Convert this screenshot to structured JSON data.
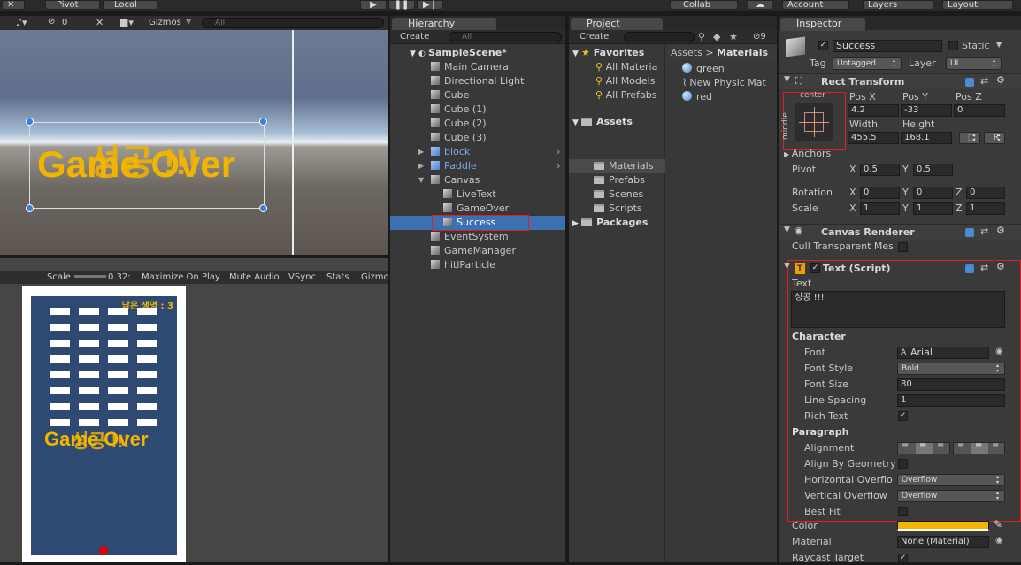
{
  "toolbar": {
    "pivot": "Pivot",
    "local": "Local",
    "collab": "Collab",
    "account": "Account",
    "layers": "Layers",
    "layout": "Layout"
  },
  "scene": {
    "gizmos": "Gizmos",
    "search_placeholder": "All",
    "layers_count": "0",
    "overlay_a": "Game Over",
    "overlay_b": "성공 !!!"
  },
  "game": {
    "scale_label": "Scale",
    "scale_value": "0.32:",
    "maximize": "Maximize On Play",
    "mute": "Mute Audio",
    "vsync": "VSync",
    "stats": "Stats",
    "gizmos": "Gizmo",
    "lives": "남은 생명 : 3",
    "overlay_a": "Game Over",
    "overlay_b": "성공 !!!"
  },
  "hierarchy": {
    "tab": "Hierarchy",
    "create": "Create",
    "search_placeholder": "All",
    "scene": "SampleScene*",
    "items": [
      "Main Camera",
      "Directional Light",
      "Cube",
      "Cube (1)",
      "Cube (2)",
      "Cube (3)",
      "block",
      "Paddle",
      "Canvas",
      "LiveText",
      "GameOver",
      "Success",
      "EventSystem",
      "GameManager",
      "hitlParticle"
    ]
  },
  "project": {
    "tab": "Project",
    "create": "Create",
    "badge": "9",
    "favorites": "Favorites",
    "fav_items": [
      "All Materia",
      "All Models",
      "All Prefabs"
    ],
    "assets": "Assets",
    "asset_items": [
      "Materials",
      "Prefabs",
      "Scenes",
      "Scripts"
    ],
    "packages": "Packages",
    "crumb_root": "Assets",
    "crumb_sep": ">",
    "crumb_leaf": "Materials",
    "files": [
      "green",
      "New Physic Mat",
      "red"
    ]
  },
  "inspector": {
    "tab": "Inspector",
    "name": "Success",
    "static": "Static",
    "tag_label": "Tag",
    "tag": "Untagged",
    "layer_label": "Layer",
    "layer": "UI",
    "rect": {
      "title": "Rect Transform",
      "anchor_top": "center",
      "anchor_side": "middle",
      "posx_l": "Pos X",
      "posy_l": "Pos Y",
      "posz_l": "Pos Z",
      "posx": "4.2",
      "posy": "-33",
      "posz": "0",
      "width_l": "Width",
      "height_l": "Height",
      "width": "455.5",
      "height": "168.1",
      "r_btn": "R",
      "anchors": "Anchors",
      "pivot": "Pivot",
      "pivot_x": "0.5",
      "pivot_y": "0.5",
      "rotation": "Rotation",
      "rot_x": "0",
      "rot_y": "0",
      "rot_z": "0",
      "scale": "Scale",
      "sc_x": "1",
      "sc_y": "1",
      "sc_z": "1",
      "x": "X",
      "y": "Y",
      "z": "Z"
    },
    "canvas_renderer": {
      "title": "Canvas Renderer",
      "cull": "Cull Transparent Mes"
    },
    "text": {
      "title": "Text (Script)",
      "text_label": "Text",
      "text_value": "성공 !!!",
      "character": "Character",
      "font_l": "Font",
      "font": "Arial",
      "style_l": "Font Style",
      "style": "Bold",
      "size_l": "Font Size",
      "size": "80",
      "spacing_l": "Line Spacing",
      "spacing": "1",
      "rich_l": "Rich Text",
      "paragraph": "Paragraph",
      "align_l": "Alignment",
      "geom_l": "Align By Geometry",
      "hov_l": "Horizontal Overflo",
      "hov": "Overflow",
      "vov_l": "Vertical Overflow",
      "vov": "Overflow",
      "best_l": "Best Fit",
      "color_l": "Color",
      "material_l": "Material",
      "material": "None (Material)",
      "raycast_l": "Raycast Target"
    }
  },
  "colors": {
    "accent": "#3d6fb3",
    "selected": "#3d6fb3",
    "text_orange": "#f3b400",
    "highlight_red": "#e02020"
  }
}
